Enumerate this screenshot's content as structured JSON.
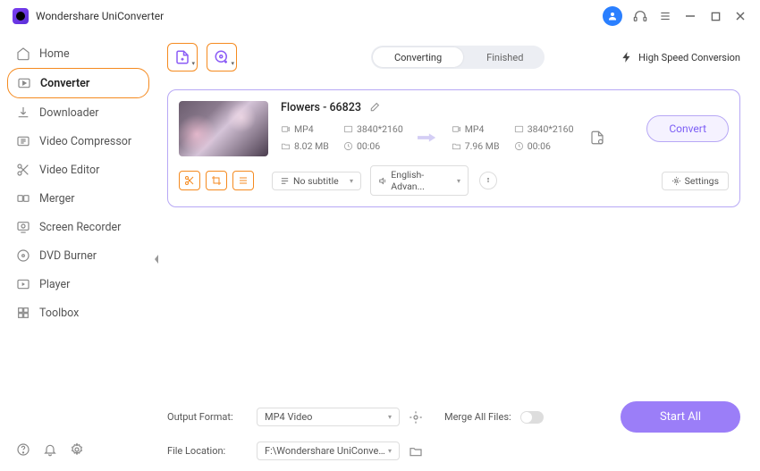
{
  "app": {
    "title": "Wondershare UniConverter"
  },
  "sidebar": {
    "items": [
      {
        "label": "Home"
      },
      {
        "label": "Converter"
      },
      {
        "label": "Downloader"
      },
      {
        "label": "Video Compressor"
      },
      {
        "label": "Video Editor"
      },
      {
        "label": "Merger"
      },
      {
        "label": "Screen Recorder"
      },
      {
        "label": "DVD Burner"
      },
      {
        "label": "Player"
      },
      {
        "label": "Toolbox"
      }
    ]
  },
  "tabs": {
    "converting": "Converting",
    "finished": "Finished"
  },
  "topright": {
    "hispeed": "High Speed Conversion"
  },
  "file": {
    "title": "Flowers - 66823",
    "src": {
      "format": "MP4",
      "res": "3840*2160",
      "size": "8.02 MB",
      "dur": "00:06"
    },
    "dst": {
      "format": "MP4",
      "res": "3840*2160",
      "size": "7.96 MB",
      "dur": "00:06"
    },
    "subtitle": "No subtitle",
    "audio": "English-Advan...",
    "settings_label": "Settings",
    "convert_label": "Convert"
  },
  "bottom": {
    "outformat_label": "Output Format:",
    "outformat_value": "MP4 Video",
    "merge_label": "Merge All Files:",
    "fileloc_label": "File Location:",
    "fileloc_value": "F:\\Wondershare UniConverter",
    "startall": "Start All"
  }
}
